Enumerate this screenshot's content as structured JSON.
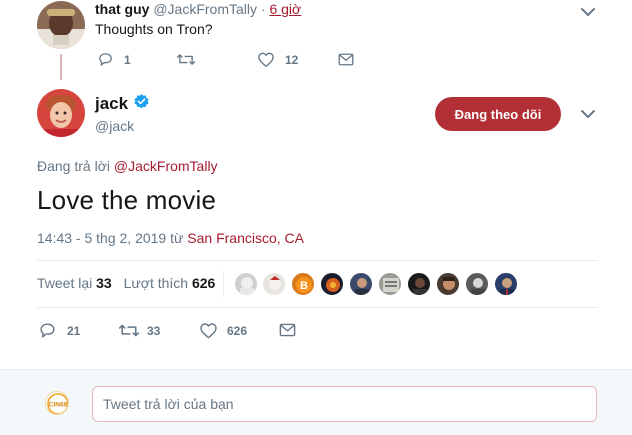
{
  "parent_tweet": {
    "display_name": "that guy",
    "handle": "@JackFromTally",
    "separator": "·",
    "time": "6 giờ",
    "text": "Thoughts on Tron?",
    "reply_count": "1",
    "like_count": "12"
  },
  "main_tweet": {
    "display_name": "jack",
    "handle": "@jack",
    "follow_label": "Đang theo dõi",
    "replying_prefix": "Đang trả lời",
    "replying_to": "@JackFromTally",
    "text": "Love the movie",
    "timestamp": "14:43 - 5 thg 2, 2019 từ",
    "location": "San Francisco, CA",
    "retweets_label": "Tweet lại",
    "retweets_count": "33",
    "likes_label": "Lượt thích",
    "likes_count": "626",
    "actions": {
      "reply_count": "21",
      "retweet_count": "33",
      "like_count": "626"
    }
  },
  "reply_composer": {
    "placeholder": "Tweet trả lời của bạn",
    "avatar_text": "CIN68"
  },
  "colors": {
    "accent": "#a51c30",
    "button": "#b32f36",
    "muted": "#657786",
    "verified": "#1da1f2"
  }
}
